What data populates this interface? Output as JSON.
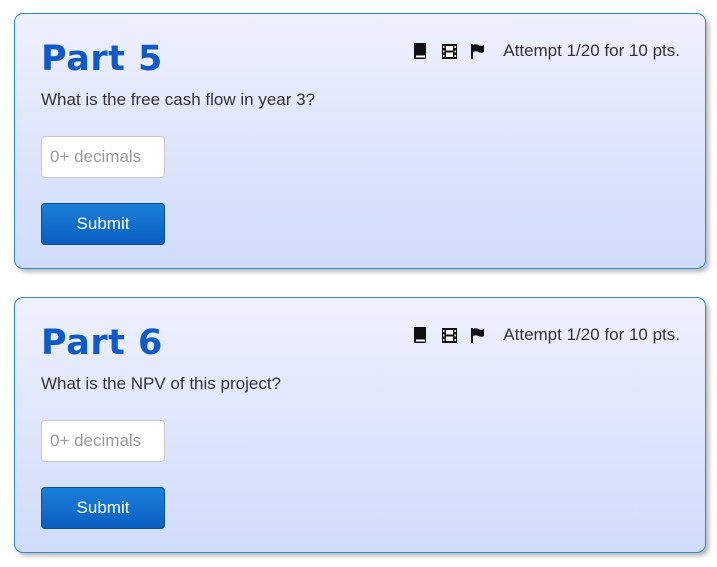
{
  "parts": [
    {
      "title": "Part 5",
      "question": "What is the free cash flow in year 3?",
      "answer_placeholder": "0+ decimals",
      "answer_value": "",
      "submit_label": "Submit",
      "attempt_text": "Attempt 1/20 for 10 pts.",
      "icons": [
        "book-icon",
        "film-icon",
        "flag-icon"
      ]
    },
    {
      "title": "Part 6",
      "question": "What is the NPV of this project?",
      "answer_placeholder": "0+ decimals",
      "answer_value": "",
      "submit_label": "Submit",
      "attempt_text": "Attempt 1/20 for 10 pts.",
      "icons": [
        "book-icon",
        "film-icon",
        "flag-icon"
      ]
    }
  ],
  "colors": {
    "title": "#0f5ac9",
    "card_border": "#2f87c9",
    "card_bg_top": "#eef0fd",
    "card_bg_bottom": "#cfdcfb",
    "button_top": "#1a7fd9",
    "button_bottom": "#0a5fc0"
  }
}
